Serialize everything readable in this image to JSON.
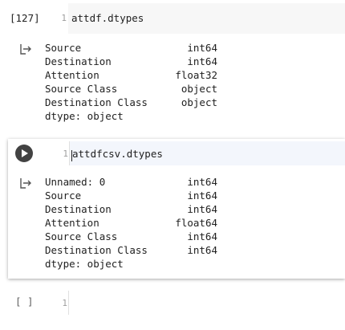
{
  "cells": [
    {
      "execution_count": "[127]",
      "line_number": "1",
      "code": "attdf.dtypes",
      "output": {
        "rows": [
          {
            "name": "Source",
            "dtype": "int64"
          },
          {
            "name": "Destination",
            "dtype": "int64"
          },
          {
            "name": "Attention",
            "dtype": "float32"
          },
          {
            "name": "Source Class",
            "dtype": "object"
          },
          {
            "name": "Destination Class",
            "dtype": "object"
          }
        ],
        "footer": "dtype: object"
      }
    },
    {
      "execution_count": "",
      "line_number": "1",
      "code": "attdfcsv.dtypes",
      "output": {
        "rows": [
          {
            "name": "Unnamed: 0",
            "dtype": "int64"
          },
          {
            "name": "Source",
            "dtype": "int64"
          },
          {
            "name": "Destination",
            "dtype": "int64"
          },
          {
            "name": "Attention",
            "dtype": "float64"
          },
          {
            "name": "Source Class",
            "dtype": "int64"
          },
          {
            "name": "Destination Class",
            "dtype": "int64"
          }
        ],
        "footer": "dtype: object"
      }
    },
    {
      "execution_count": "[ ]",
      "line_number": "1",
      "code": ""
    }
  ],
  "icons": {
    "output": "output-arrow-icon",
    "run": "play-icon"
  },
  "colors": {
    "code_bg": "#f7f7f7",
    "focused_code_bg": "#f3f6fc",
    "run_button": "#424242",
    "line_number": "#9e9e9e"
  }
}
